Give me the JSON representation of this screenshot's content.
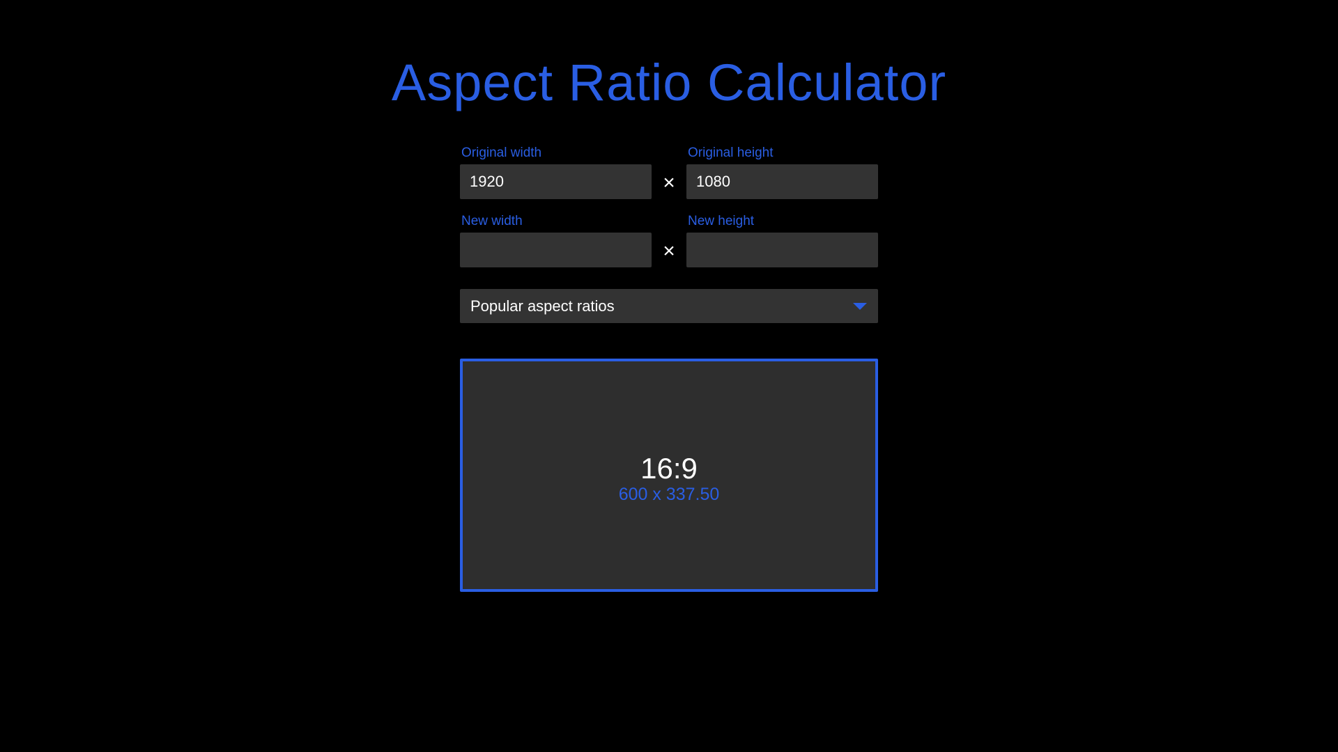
{
  "app": {
    "title": "Aspect Ratio Calculator"
  },
  "original": {
    "width_label": "Original width",
    "width_value": "1920",
    "height_label": "Original height",
    "height_value": "1080",
    "separator": "×"
  },
  "new": {
    "width_label": "New width",
    "width_value": "",
    "height_label": "New height",
    "height_value": "",
    "separator": "×"
  },
  "presets": {
    "selected_label": "Popular aspect ratios",
    "icon": "caret-down-icon"
  },
  "preview": {
    "ratio": "16:9",
    "dimensions": "600 x 337.50"
  },
  "colors": {
    "accent": "#2a5ee3",
    "background": "#000000",
    "field_background": "#333333",
    "preview_background": "#2e2e2e",
    "text": "#ffffff"
  }
}
